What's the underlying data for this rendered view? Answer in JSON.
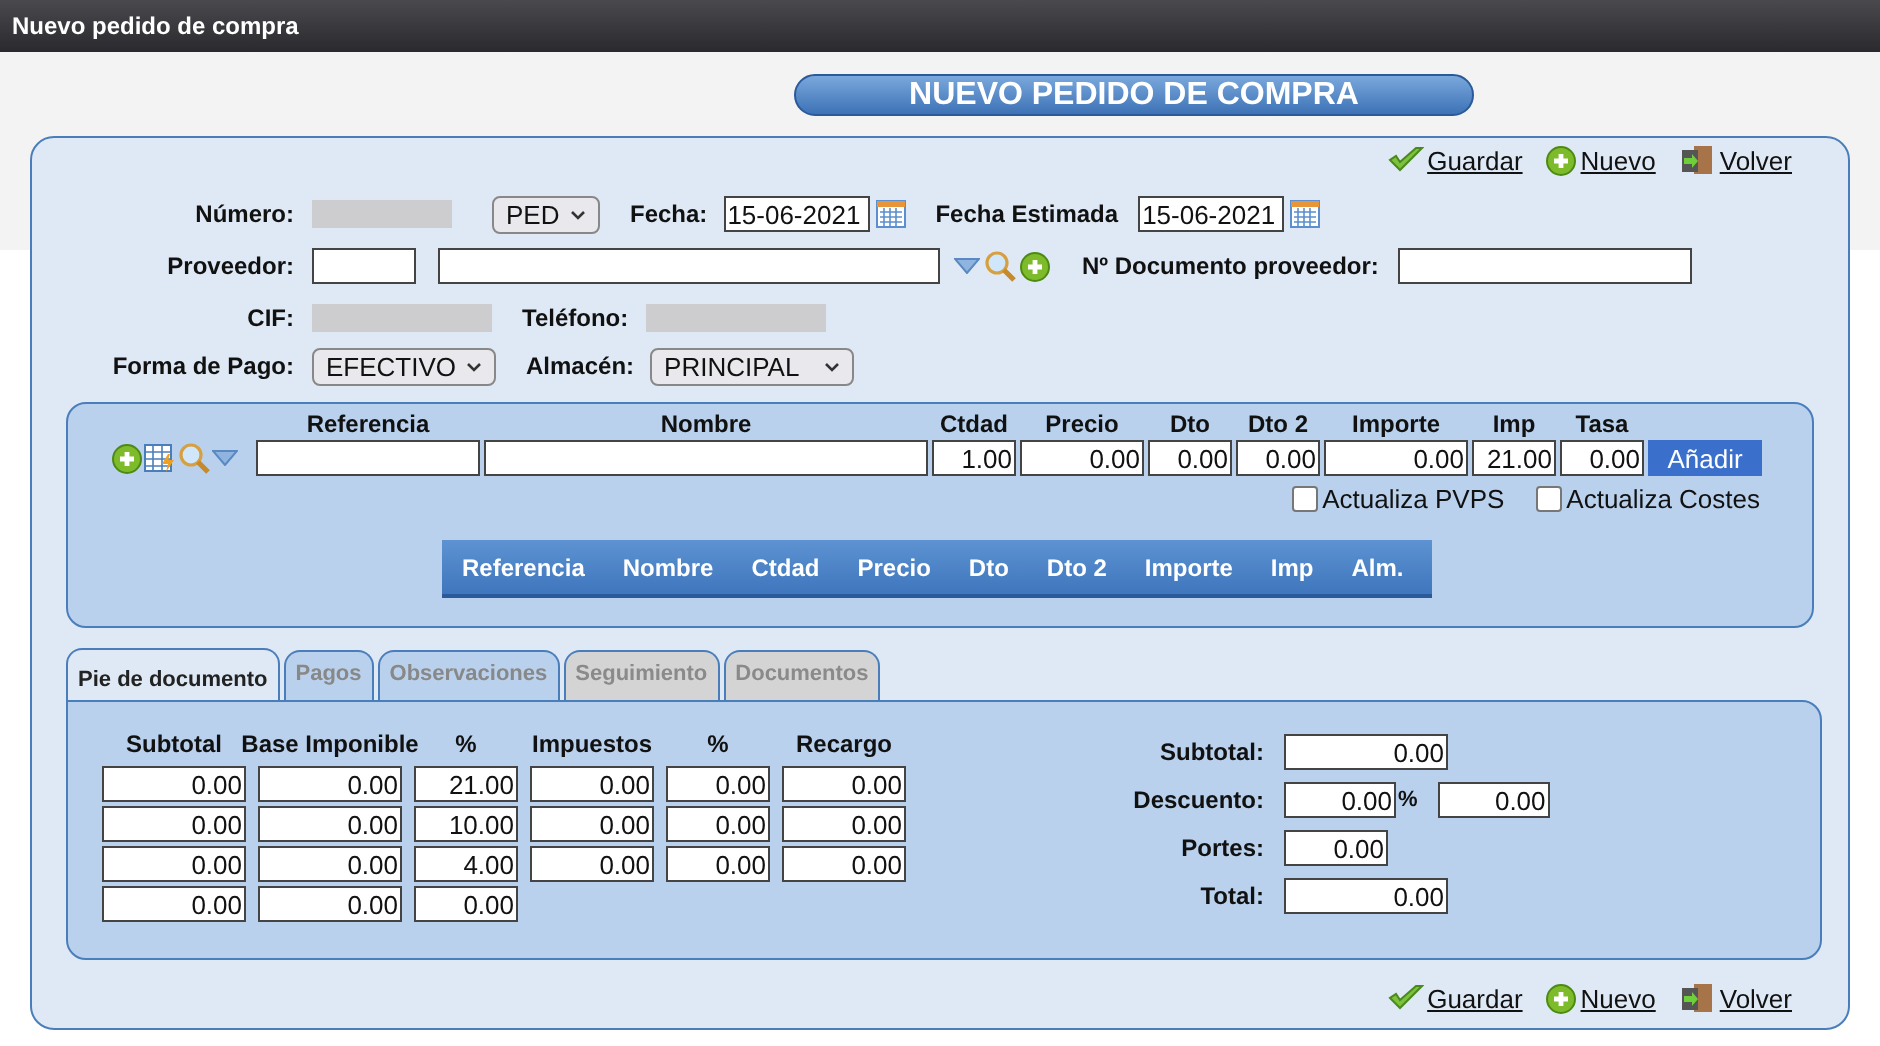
{
  "window": {
    "title": "Nuevo pedido de compra"
  },
  "header": "NUEVO PEDIDO DE COMPRA",
  "actions_top": [
    {
      "kind": "save",
      "label": "Guardar"
    },
    {
      "kind": "new",
      "label": "Nuevo"
    },
    {
      "kind": "back",
      "label": "Volver"
    }
  ],
  "form": {
    "numero_label": "Número:",
    "serie": "PED",
    "fecha_label": "Fecha:",
    "fecha": "15-06-2021",
    "fecha_estimada_label": "Fecha Estimada",
    "fecha_estimada": "15-06-2021",
    "proveedor_label": "Proveedor:",
    "doc_proveedor_label": "Nº Documento proveedor:",
    "cif_label": "CIF:",
    "telefono_label": "Teléfono:",
    "forma_pago_label": "Forma de Pago:",
    "forma_pago": "EFECTIVO",
    "almacen_label": "Almacén:",
    "almacen": "PRINCIPAL"
  },
  "line_entry": {
    "columns": [
      {
        "label": "Referencia"
      },
      {
        "label": "Nombre"
      },
      {
        "label": "Ctdad",
        "value": "1.00"
      },
      {
        "label": "Precio",
        "value": "0.00"
      },
      {
        "label": "Dto",
        "value": "0.00"
      },
      {
        "label": "Dto 2",
        "value": "0.00"
      },
      {
        "label": "Importe",
        "value": "0.00"
      },
      {
        "label": "Imp",
        "value": "21.00"
      },
      {
        "label": "Tasa",
        "value": "0.00"
      }
    ],
    "add_button": "Añadir",
    "checkboxes": [
      {
        "label": "Actualiza PVPS",
        "checked": false
      },
      {
        "label": "Actualiza Costes",
        "checked": false
      }
    ],
    "grid_columns": [
      "Referencia",
      "Nombre",
      "Ctdad",
      "Precio",
      "Dto",
      "Dto 2",
      "Importe",
      "Imp",
      "Alm."
    ]
  },
  "tabs": [
    {
      "label": "Pie de documento",
      "selected": true,
      "disabled": false
    },
    {
      "label": "Pagos",
      "selected": false,
      "disabled": false
    },
    {
      "label": "Observaciones",
      "selected": false,
      "disabled": false
    },
    {
      "label": "Seguimiento",
      "selected": false,
      "disabled": true
    },
    {
      "label": "Documentos",
      "selected": false,
      "disabled": true
    }
  ],
  "taxes": {
    "columns": [
      "Subtotal",
      "Base Imponible",
      "%",
      "Impuestos",
      "%",
      "Recargo"
    ],
    "rows": [
      [
        "0.00",
        "0.00",
        "21.00",
        "0.00",
        "0.00",
        "0.00"
      ],
      [
        "0.00",
        "0.00",
        "10.00",
        "0.00",
        "0.00",
        "0.00"
      ],
      [
        "0.00",
        "0.00",
        "4.00",
        "0.00",
        "0.00",
        "0.00"
      ],
      [
        "0.00",
        "0.00",
        "0.00"
      ]
    ]
  },
  "totals": [
    {
      "label": "Subtotal:",
      "value": "0.00"
    },
    {
      "label": "Descuento:",
      "value": "0.00",
      "unit": "%",
      "amount": "0.00"
    },
    {
      "label": "Portes:",
      "value": "0.00"
    },
    {
      "label": "Total:",
      "value": "0.00"
    }
  ],
  "actions_bottom": [
    {
      "kind": "save",
      "label": "Guardar"
    },
    {
      "kind": "new",
      "label": "Nuevo"
    },
    {
      "kind": "back",
      "label": "Volver"
    }
  ]
}
